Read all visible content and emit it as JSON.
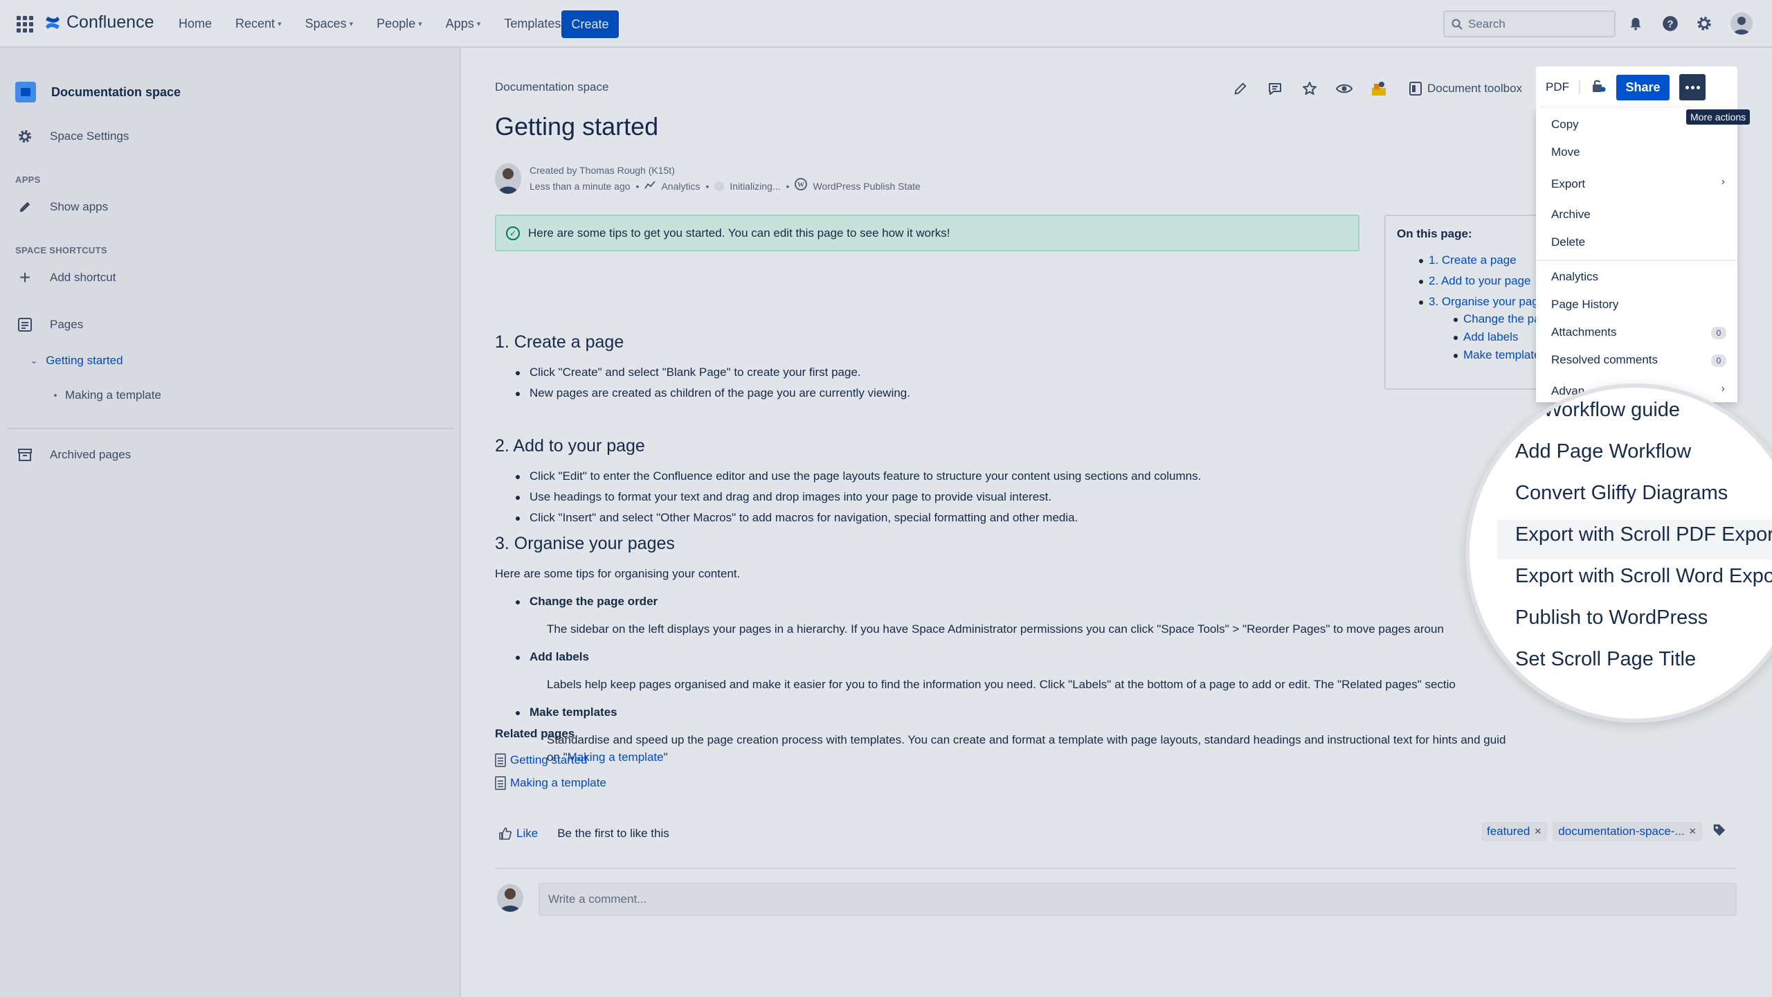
{
  "topnav": {
    "logo": "Confluence",
    "items": [
      {
        "label": "Home",
        "caret": false
      },
      {
        "label": "Recent",
        "caret": true
      },
      {
        "label": "Spaces",
        "caret": true
      },
      {
        "label": "People",
        "caret": true
      },
      {
        "label": "Apps",
        "caret": true
      },
      {
        "label": "Templates",
        "caret": false
      }
    ],
    "create": "Create",
    "search_placeholder": "Search"
  },
  "sidebar": {
    "space_title": "Documentation space",
    "space_settings": "Space Settings",
    "apps_label": "APPS",
    "show_apps": "Show apps",
    "shortcuts_label": "SPACE SHORTCUTS",
    "add_shortcut": "Add shortcut",
    "pages": "Pages",
    "tree_current": "Getting started",
    "tree_child": "Making a template",
    "archived": "Archived pages"
  },
  "page": {
    "breadcrumb": "Documentation space",
    "title": "Getting started",
    "doc_toolbox": "Document toolbox",
    "byline": {
      "created_by": "Created by Thomas Rough (K15t)",
      "time": "Less than a minute ago",
      "analytics": "Analytics",
      "initializing": "Initializing...",
      "wp_state": "WordPress Publish State"
    },
    "tip": "Here are some tips to get you started. You can edit this page to see how it works!",
    "s1_title": "1. Create a page",
    "s1_b1": "Click \"Create\" and select \"Blank Page\" to create your first page.",
    "s1_b2": "New pages are created as children of the page you are currently viewing.",
    "s2_title": "2. Add to your page",
    "s2_b1": "Click \"Edit\" to enter the Confluence editor and use the page layouts feature to structure your content using sections and columns.",
    "s2_b2": "Use headings to format your text and drag and drop images into your page to provide visual interest.",
    "s2_b3": "Click \"Insert\" and select \"Other Macros\" to add macros for navigation, special formatting and other media.",
    "s3_title": "3. Organise your pages",
    "s3_intro": "Here are some tips for organising your content.",
    "s3_b1_title": "Change the page order",
    "s3_b1_text": "The sidebar on the left displays your pages in a hierarchy. If you have Space Administrator permissions you can click \"Space Tools\" > \"Reorder Pages\" to move pages aroun",
    "s3_b2_title": "Add labels",
    "s3_b2_text": "Labels help keep pages organised and make it easier for you to find the information you need. Click \"Labels\" at the bottom of a page to add or edit. The \"Related pages\" sectio",
    "s3_b3_title": "Make templates",
    "s3_b3_text": "Standardise and speed up the page creation process with templates. You can create and format a template with page layouts, standard headings and instructional text for hints and guid",
    "s3_b3_on": "on \"",
    "s3_b3_link": "Making a template",
    "s3_b3_end": "\"",
    "related_title": "Related pages",
    "related": [
      "Getting started",
      "Making a template"
    ],
    "like": "Like",
    "like_text": "Be the first to like this",
    "labels": [
      "featured",
      "documentation-space-..."
    ],
    "comment_placeholder": "Write a comment..."
  },
  "toc": {
    "title": "On this page:",
    "items": [
      "1. Create a page",
      "2. Add to your page",
      "3. Organise your pag",
      "Change the pa",
      "Add labels",
      "Make template"
    ]
  },
  "actions": {
    "pdf": "PDF",
    "share": "Share",
    "tooltip": "More actions"
  },
  "menu": {
    "copy": "Copy",
    "move": "Move",
    "export": "Export",
    "archive": "Archive",
    "delete": "Delete",
    "analytics": "Analytics",
    "history": "Page History",
    "attachments": "Attachments",
    "attachments_count": "0",
    "resolved": "Resolved comments",
    "resolved_count": "0",
    "advanced": "Advan"
  },
  "magnifier": {
    "items": [
      "ge Workflow guide",
      "Add Page Workflow",
      "Convert Gliffy Diagrams",
      "Export with Scroll PDF Exporter",
      "Export with Scroll Word Exporter",
      "Publish to WordPress",
      "Set Scroll Page Title"
    ]
  },
  "colors": {
    "accent": "#0052cc",
    "success_bg": "#e3fcef",
    "dark": "#253858"
  }
}
